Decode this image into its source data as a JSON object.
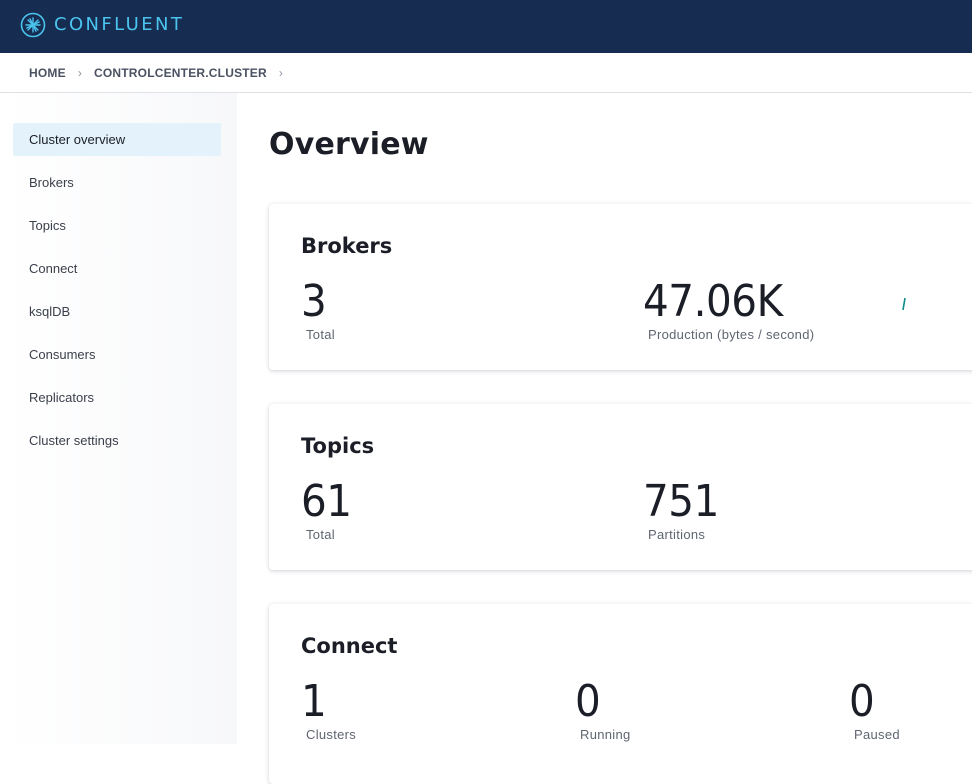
{
  "header": {
    "brand": "CONFLUENT",
    "logo_icon": "confluent-logo-icon",
    "bg_color": "#172c51",
    "brand_color": "#4ac4ee"
  },
  "breadcrumb": {
    "items": [
      "HOME",
      "CONTROLCENTER.CLUSTER"
    ],
    "separator": "›"
  },
  "sidebar": {
    "items": [
      {
        "label": "Cluster overview",
        "active": true
      },
      {
        "label": "Brokers"
      },
      {
        "label": "Topics"
      },
      {
        "label": "Connect"
      },
      {
        "label": "ksqlDB"
      },
      {
        "label": "Consumers"
      },
      {
        "label": "Replicators"
      },
      {
        "label": "Cluster settings"
      }
    ],
    "active_color": "#e3f2fb"
  },
  "main": {
    "title": "Overview",
    "cards": {
      "brokers": {
        "title": "Brokers",
        "total_value": "3",
        "total_label": "Total",
        "production_value": "47.06K",
        "production_label": "Production (bytes / second)",
        "sparkline_color": "#0f8a8a"
      },
      "topics": {
        "title": "Topics",
        "total_value": "61",
        "total_label": "Total",
        "partitions_value": "751",
        "partitions_label": "Partitions"
      },
      "connect": {
        "title": "Connect",
        "clusters_value": "1",
        "clusters_label": "Clusters",
        "running_value": "0",
        "running_label": "Running",
        "paused_value": "0",
        "paused_label": "Paused"
      }
    }
  }
}
